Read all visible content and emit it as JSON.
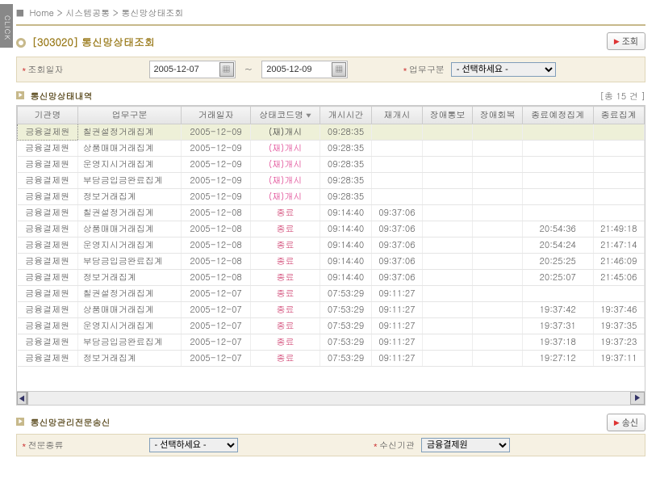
{
  "click_tab": "CLICK",
  "breadcrumb": {
    "home": "Home",
    "sep": ">",
    "menu1": "시스템공통",
    "menu2": "통신망상태조회"
  },
  "page": {
    "code": "[303020]",
    "title": "통신망상태조회",
    "search_btn": "조회"
  },
  "filter": {
    "date_label": "조회일자",
    "date_from": "2005-12-07",
    "date_to": "2005-12-09",
    "biz_label": "업무구분",
    "biz_select": "- 선택하세요 -"
  },
  "section_list": {
    "title": "통신망상태내역",
    "count_prefix": "[총",
    "count_value": "15",
    "count_suffix": "건 ]"
  },
  "grid": {
    "cols": [
      "기관명",
      "업무구분",
      "거래일자",
      "상태코드명",
      "개시시간",
      "재개시",
      "장애통보",
      "장애회복",
      "종료예정집계",
      "종료집계"
    ],
    "rows": [
      {
        "inst": "금융결제원",
        "biz": "칠권설정거래집계",
        "date": "2005-12-09",
        "status": "(재)개시",
        "status_class": "black",
        "start": "09:28:35",
        "restart": "",
        "fault_n": "",
        "fault_r": "",
        "end_sched": "",
        "end": ""
      },
      {
        "inst": "금융결제원",
        "biz": "상품매매거래집계",
        "date": "2005-12-09",
        "status": "(재)개시",
        "status_class": "pink",
        "start": "09:28:35",
        "restart": "",
        "fault_n": "",
        "fault_r": "",
        "end_sched": "",
        "end": ""
      },
      {
        "inst": "금융결제원",
        "biz": "운영지시거래집계",
        "date": "2005-12-09",
        "status": "(재)개시",
        "status_class": "pink",
        "start": "09:28:35",
        "restart": "",
        "fault_n": "",
        "fault_r": "",
        "end_sched": "",
        "end": ""
      },
      {
        "inst": "금융결제원",
        "biz": "부담금입금완료집계",
        "date": "2005-12-09",
        "status": "(재)개시",
        "status_class": "pink",
        "start": "09:28:35",
        "restart": "",
        "fault_n": "",
        "fault_r": "",
        "end_sched": "",
        "end": ""
      },
      {
        "inst": "금융결제원",
        "biz": "정보거래집계",
        "date": "2005-12-09",
        "status": "(재)개시",
        "status_class": "pink",
        "start": "09:28:35",
        "restart": "",
        "fault_n": "",
        "fault_r": "",
        "end_sched": "",
        "end": ""
      },
      {
        "inst": "금융결제원",
        "biz": "칠권설정거래집계",
        "date": "2005-12-08",
        "status": "종료",
        "status_class": "end",
        "start": "09:14:40",
        "restart": "09:37:06",
        "fault_n": "",
        "fault_r": "",
        "end_sched": "",
        "end": ""
      },
      {
        "inst": "금융결제원",
        "biz": "상품매매거래집계",
        "date": "2005-12-08",
        "status": "종료",
        "status_class": "end",
        "start": "09:14:40",
        "restart": "09:37:06",
        "fault_n": "",
        "fault_r": "",
        "end_sched": "20:54:36",
        "end": "21:49:18"
      },
      {
        "inst": "금융결제원",
        "biz": "운영지시거래집계",
        "date": "2005-12-08",
        "status": "종료",
        "status_class": "end",
        "start": "09:14:40",
        "restart": "09:37:06",
        "fault_n": "",
        "fault_r": "",
        "end_sched": "20:54:24",
        "end": "21:47:14"
      },
      {
        "inst": "금융결제원",
        "biz": "부담금입금완료집계",
        "date": "2005-12-08",
        "status": "종료",
        "status_class": "end",
        "start": "09:14:40",
        "restart": "09:37:06",
        "fault_n": "",
        "fault_r": "",
        "end_sched": "20:25:25",
        "end": "21:46:09"
      },
      {
        "inst": "금융결제원",
        "biz": "정보거래집계",
        "date": "2005-12-08",
        "status": "종료",
        "status_class": "end",
        "start": "09:14:40",
        "restart": "09:37:06",
        "fault_n": "",
        "fault_r": "",
        "end_sched": "20:25:07",
        "end": "21:45:06"
      },
      {
        "inst": "금융결제원",
        "biz": "칠권설정거래집계",
        "date": "2005-12-07",
        "status": "종료",
        "status_class": "end",
        "start": "07:53:29",
        "restart": "09:11:27",
        "fault_n": "",
        "fault_r": "",
        "end_sched": "",
        "end": ""
      },
      {
        "inst": "금융결제원",
        "biz": "상품매매거래집계",
        "date": "2005-12-07",
        "status": "종료",
        "status_class": "end",
        "start": "07:53:29",
        "restart": "09:11:27",
        "fault_n": "",
        "fault_r": "",
        "end_sched": "19:37:42",
        "end": "19:37:46"
      },
      {
        "inst": "금융결제원",
        "biz": "운영지시거래집계",
        "date": "2005-12-07",
        "status": "종료",
        "status_class": "end",
        "start": "07:53:29",
        "restart": "09:11:27",
        "fault_n": "",
        "fault_r": "",
        "end_sched": "19:37:31",
        "end": "19:37:35"
      },
      {
        "inst": "금융결제원",
        "biz": "부담금입금완료집계",
        "date": "2005-12-07",
        "status": "종료",
        "status_class": "end",
        "start": "07:53:29",
        "restart": "09:11:27",
        "fault_n": "",
        "fault_r": "",
        "end_sched": "19:37:18",
        "end": "19:37:23"
      },
      {
        "inst": "금융결제원",
        "biz": "정보거래집계",
        "date": "2005-12-07",
        "status": "종료",
        "status_class": "end",
        "start": "07:53:29",
        "restart": "09:11:27",
        "fault_n": "",
        "fault_r": "",
        "end_sched": "19:27:12",
        "end": "19:37:11"
      }
    ]
  },
  "section_send": {
    "title": "통신망관리전문송신",
    "send_btn": "송신",
    "msg_type_label": "전문종류",
    "msg_type_select": "- 선택하세요 -",
    "recv_label": "수신기관",
    "recv_select": "금융결제원"
  }
}
